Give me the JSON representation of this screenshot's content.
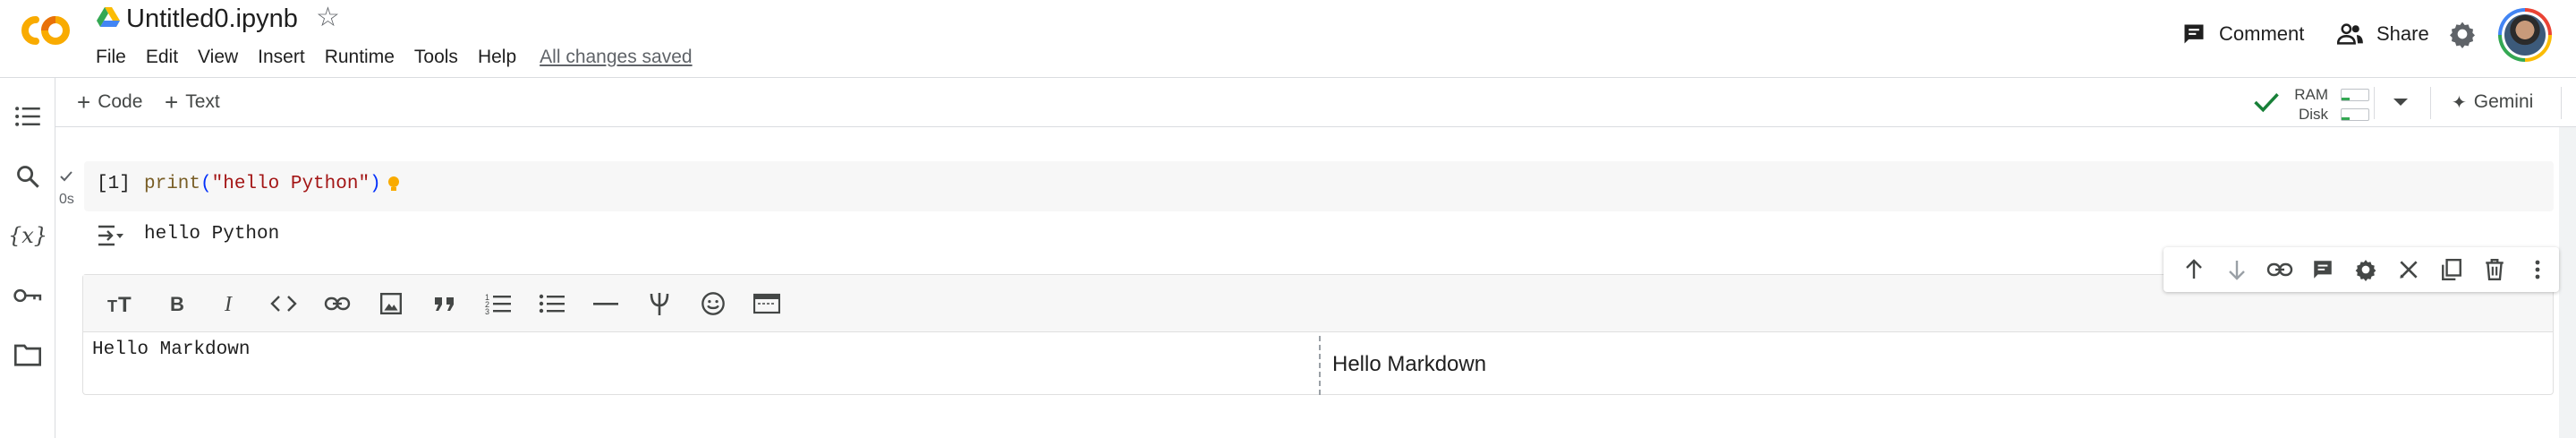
{
  "header": {
    "title": "Untitled0.ipynb",
    "menu": [
      "File",
      "Edit",
      "View",
      "Insert",
      "Runtime",
      "Tools",
      "Help"
    ],
    "saved_status": "All changes saved",
    "comment_label": "Comment",
    "share_label": "Share"
  },
  "toolbar": {
    "add_code": "Code",
    "add_text": "Text",
    "ram_label": "RAM",
    "disk_label": "Disk",
    "gemini_label": "Gemini"
  },
  "code_cell": {
    "exec_count": "[1]",
    "exec_time": "0s",
    "code_fn": "print",
    "code_open": "(",
    "code_str": "\"hello Python\"",
    "code_close": ")",
    "output": "hello Python"
  },
  "text_cell": {
    "source": "Hello Markdown",
    "preview": "Hello Markdown"
  },
  "colors": {
    "accent": "#1a73e8",
    "logo_orange": "#f9ab00",
    "success_green": "#188038"
  }
}
